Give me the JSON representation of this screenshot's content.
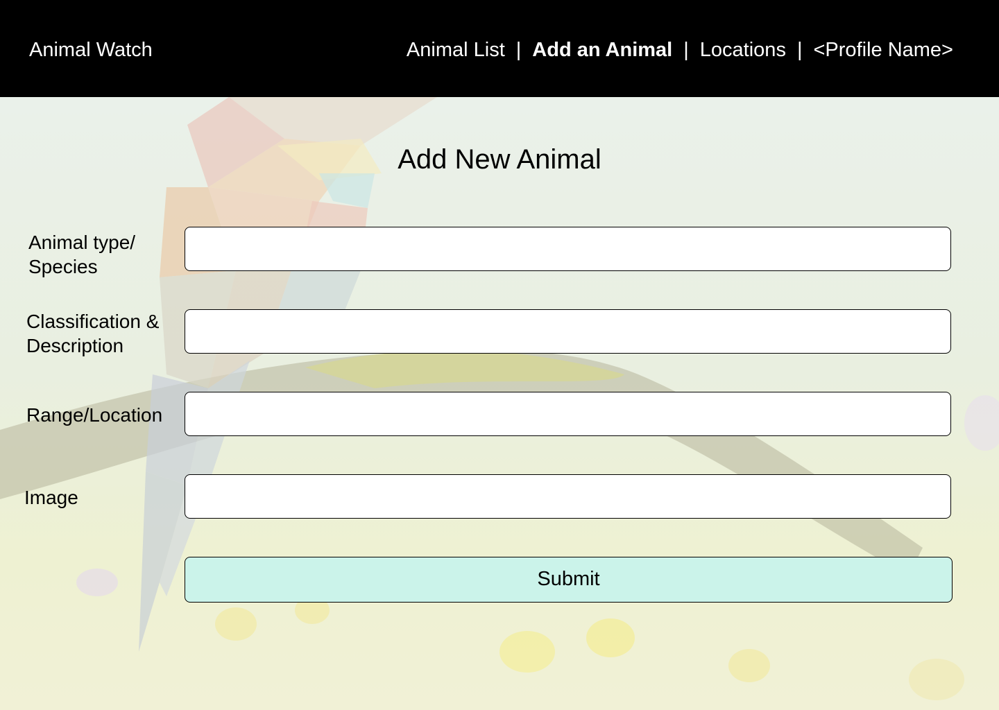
{
  "header": {
    "brand": "Animal Watch",
    "nav": {
      "animal_list": "Animal List",
      "add_animal": "Add an Animal",
      "locations": "Locations",
      "profile": "<Profile Name>",
      "separator": "|"
    }
  },
  "form": {
    "title": "Add New Animal",
    "fields": {
      "species_label_line1": "Animal type/",
      "species_label_line2": "Species",
      "species_value": "",
      "classification_label_line1": "Classification &",
      "classification_label_line2": "Description",
      "classification_value": "",
      "range_label": "Range/Location",
      "range_value": "",
      "image_label": "Image",
      "image_value": ""
    },
    "submit_label": "Submit"
  },
  "colors": {
    "header_bg": "#000000",
    "submit_bg": "#cbf3ea"
  }
}
